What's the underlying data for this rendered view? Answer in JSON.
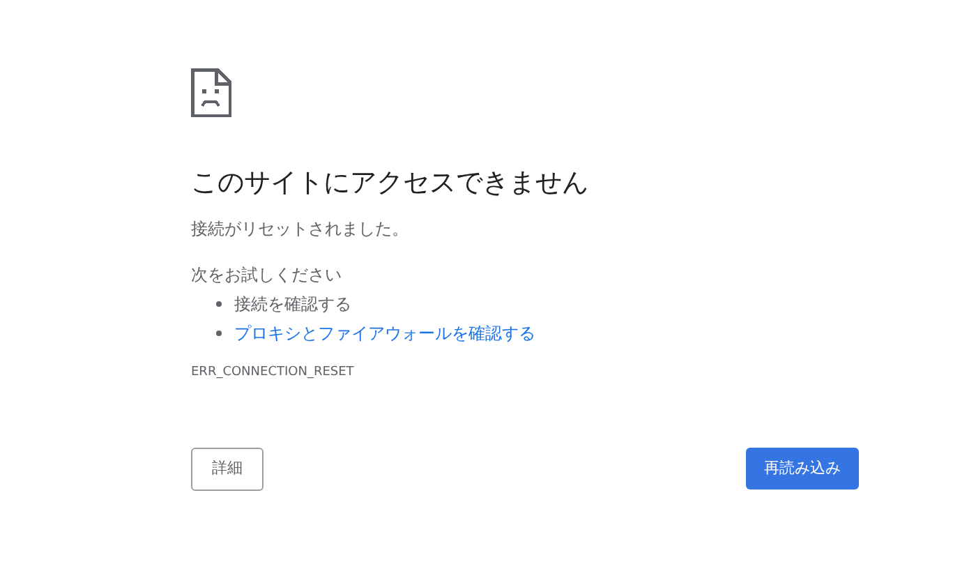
{
  "heading": "このサイトにアクセスできません",
  "message": "接続がリセットされました。",
  "suggestions_title": "次をお試しください",
  "suggestions": [
    {
      "kind": "text",
      "label": "接続を確認する"
    },
    {
      "kind": "link",
      "label": "プロキシとファイアウォールを確認する"
    }
  ],
  "error_code": "ERR_CONNECTION_RESET",
  "buttons": {
    "details": "詳細",
    "reload": "再読み込み"
  }
}
